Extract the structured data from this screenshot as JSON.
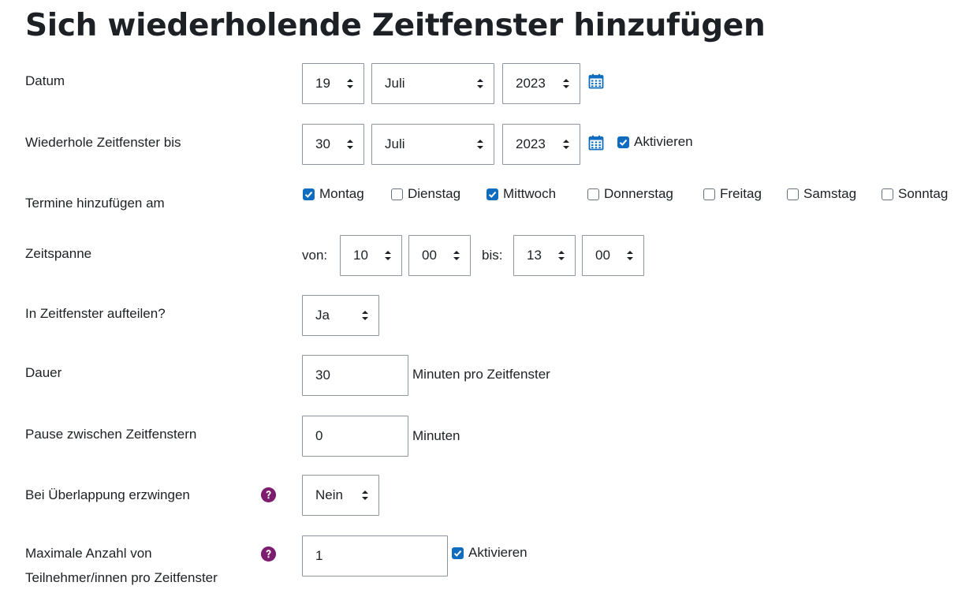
{
  "page": {
    "title": "Sich wiederholende Zeitfenster hinzufügen"
  },
  "colors": {
    "accent": "#0f6cbf",
    "help_icon": "#7c1d6f",
    "border": "#8f959e",
    "text": "#1d2125"
  },
  "labels": {
    "datum": "Datum",
    "repeat_until": "Wiederhole Zeitfenster bis",
    "days": "Termine hinzufügen am",
    "timespan": "Zeitspanne",
    "split": "In Zeitfenster aufteilen?",
    "duration": "Dauer",
    "pause": "Pause zwischen Zeitfenstern",
    "force_overlap": "Bei Überlappung erzwingen",
    "max_participants_line1": "Maximale Anzahl von",
    "max_participants_line2": "Teilnehmer/innen pro Zeitfenster"
  },
  "date": {
    "day": "19",
    "month": "Juli",
    "year": "2023"
  },
  "repeat_until": {
    "day": "30",
    "month": "Juli",
    "year": "2023",
    "enable_label": "Aktivieren",
    "enabled": true
  },
  "weekdays": [
    {
      "label": "Montag",
      "checked": true
    },
    {
      "label": "Dienstag",
      "checked": false
    },
    {
      "label": "Mittwoch",
      "checked": true
    },
    {
      "label": "Donnerstag",
      "checked": false
    },
    {
      "label": "Freitag",
      "checked": false
    },
    {
      "label": "Samstag",
      "checked": false
    },
    {
      "label": "Sonntag",
      "checked": false
    }
  ],
  "timespan": {
    "from_label": "von:",
    "from_hour": "10",
    "from_minute": "00",
    "to_label": "bis:",
    "to_hour": "13",
    "to_minute": "00"
  },
  "split": {
    "value": "Ja"
  },
  "duration": {
    "value": "30",
    "unit": "Minuten pro Zeitfenster"
  },
  "pause": {
    "value": "0",
    "unit": "Minuten"
  },
  "force_overlap": {
    "value": "Nein"
  },
  "max_participants": {
    "value": "1",
    "enable_label": "Aktivieren",
    "enabled": true
  }
}
